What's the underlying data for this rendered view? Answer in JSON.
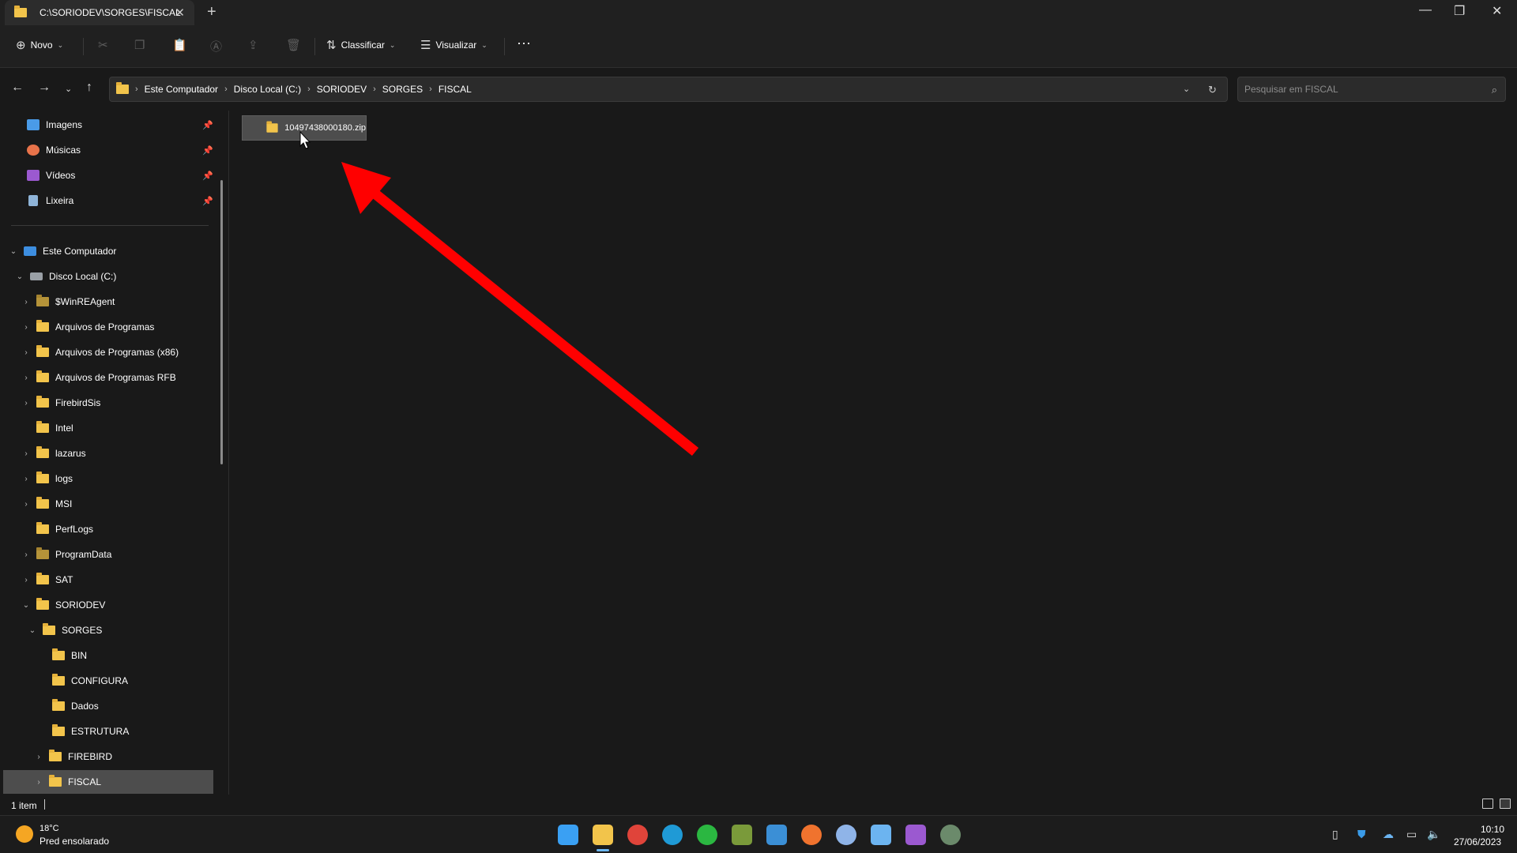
{
  "window": {
    "tab_title": "C:\\SORIODEV\\SORGES\\FISCAL",
    "controls": {
      "minimize": "—",
      "maximize": "❐",
      "close": "✕"
    }
  },
  "toolbar": {
    "new_label": "Novo",
    "sort_label": "Classificar",
    "view_label": "Visualizar",
    "more_label": "···"
  },
  "address": {
    "crumbs": [
      "Este Computador",
      "Disco Local (C:)",
      "SORIODEV",
      "SORGES",
      "FISCAL"
    ],
    "search_placeholder": "Pesquisar em FISCAL"
  },
  "sidebar": {
    "quick_access": [
      {
        "label": "Imagens",
        "icon": "images-icon",
        "color": "#4a9be8"
      },
      {
        "label": "Músicas",
        "icon": "music-icon",
        "color": "#e8734a"
      },
      {
        "label": "Vídeos",
        "icon": "videos-icon",
        "color": "#9b59d0"
      },
      {
        "label": "Lixeira",
        "icon": "recycle-bin-icon",
        "color": "#8fb4d8"
      }
    ],
    "tree": [
      {
        "label": "Este Computador"
      },
      {
        "label": "Disco Local (C:)"
      },
      {
        "label": "$WinREAgent"
      },
      {
        "label": "Arquivos de Programas"
      },
      {
        "label": "Arquivos de Programas (x86)"
      },
      {
        "label": "Arquivos de Programas RFB"
      },
      {
        "label": "FirebirdSis"
      },
      {
        "label": "Intel"
      },
      {
        "label": "lazarus"
      },
      {
        "label": "logs"
      },
      {
        "label": "MSI"
      },
      {
        "label": "PerfLogs"
      },
      {
        "label": "ProgramData"
      },
      {
        "label": "SAT"
      },
      {
        "label": "SORIODEV"
      },
      {
        "label": "SORGES"
      },
      {
        "label": "BIN"
      },
      {
        "label": "CONFIGURA"
      },
      {
        "label": "Dados"
      },
      {
        "label": "ESTRUTURA"
      },
      {
        "label": "FIREBIRD"
      },
      {
        "label": "FISCAL"
      }
    ]
  },
  "content": {
    "files": [
      {
        "name": "10497438000180.zip"
      }
    ]
  },
  "status": {
    "item_count": "1 item"
  },
  "taskbar": {
    "weather_temp": "18°C",
    "weather_desc": "Pred ensolarado",
    "time": "10:10",
    "date": "27/06/2023",
    "apps": [
      {
        "name": "start-icon",
        "color": "#3aa0f3"
      },
      {
        "name": "file-explorer-icon",
        "color": "#f2c44b"
      },
      {
        "name": "chrome-icon",
        "color": "#e0443a"
      },
      {
        "name": "edge-icon",
        "color": "#1f9ad6"
      },
      {
        "name": "whatsapp-icon",
        "color": "#2bb741"
      },
      {
        "name": "spreadsheet-icon",
        "color": "#7a9a3a"
      },
      {
        "name": "remote-desktop-icon",
        "color": "#3b8fd6"
      },
      {
        "name": "firefox-icon",
        "color": "#f0732e"
      },
      {
        "name": "settings-gear-icon",
        "color": "#8fb4e8"
      },
      {
        "name": "notepad-icon",
        "color": "#6cb4f0"
      },
      {
        "name": "video-editor-icon",
        "color": "#9b59d0"
      },
      {
        "name": "sorges-app-icon",
        "color": "#6b8a6b"
      }
    ]
  },
  "colors": {
    "annotation_arrow": "#ff0000"
  }
}
